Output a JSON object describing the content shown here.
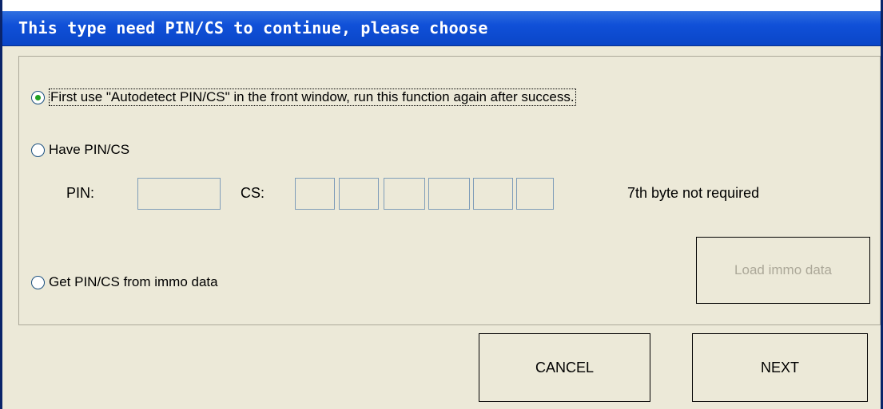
{
  "window": {
    "title": "This type need PIN/CS to continue, please choose"
  },
  "options": {
    "autodetect": {
      "label": "First use \"Autodetect PIN/CS\" in the front window, run this function again after success.",
      "checked": true
    },
    "have_pin": {
      "label": "Have PIN/CS",
      "checked": false
    },
    "immo_data": {
      "label": "Get PIN/CS from immo data",
      "checked": false
    }
  },
  "pin_section": {
    "pin_label": "PIN:",
    "pin_value": "",
    "cs_label": "CS:",
    "cs_values": [
      "",
      "",
      "",
      "",
      "",
      ""
    ],
    "note": "7th byte not required"
  },
  "buttons": {
    "load_immo": "Load immo data",
    "cancel": "CANCEL",
    "next": "NEXT"
  }
}
